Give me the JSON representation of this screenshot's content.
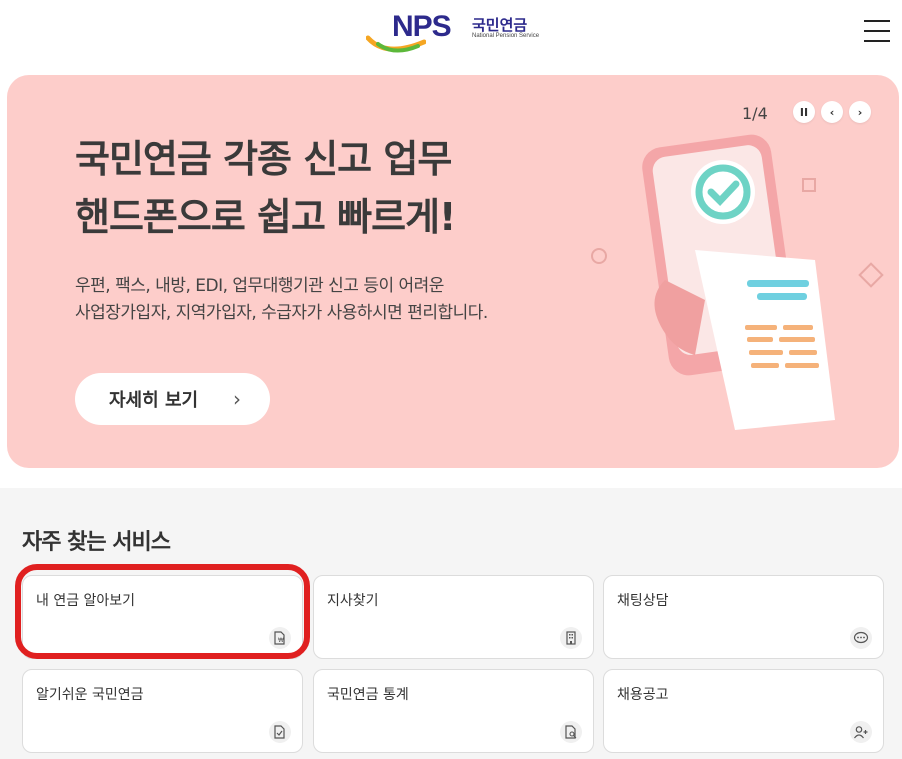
{
  "header": {
    "logo_text": "NPS",
    "logo_korean": "국민연금",
    "logo_english": "National Pension Service"
  },
  "banner": {
    "counter": "1/4",
    "title_line1": "국민연금 각종 신고 업무",
    "title_line2": "핸드폰으로 쉽고 빠르게!",
    "desc_line1": "우편, 팩스, 내방, EDI, 업무대행기관 신고 등이 어려운",
    "desc_line2": "사업장가입자, 지역가입자, 수급자가 사용하시면 편리합니다.",
    "detail_label": "자세히 보기",
    "background": "#fdcdca"
  },
  "services": {
    "title": "자주 찾는 서비스",
    "items": [
      {
        "label": "내 연금 알아보기",
        "icon": "pension-document-icon"
      },
      {
        "label": "지사찾기",
        "icon": "building-icon"
      },
      {
        "label": "채팅상담",
        "icon": "chat-icon"
      },
      {
        "label": "알기쉬운 국민연금",
        "icon": "document-check-icon"
      },
      {
        "label": "국민연금 통계",
        "icon": "document-search-icon"
      },
      {
        "label": "채용공고",
        "icon": "person-add-icon"
      }
    ]
  },
  "colors": {
    "brand": "#2d2a8c",
    "highlight": "#e02020"
  }
}
